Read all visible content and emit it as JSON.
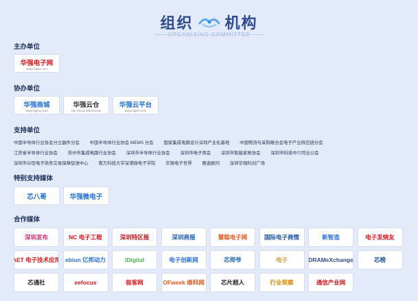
{
  "header": {
    "title_left": "组织",
    "title_right": "机构",
    "subtitle": "ORGANIZING COMMITTEE"
  },
  "sections": {
    "host": "主办单位",
    "co_host": "协办单位",
    "support": "支持单位",
    "special_media": "特别支持媒体",
    "media": "合作媒体"
  },
  "host_logos": [
    {
      "main": "华强电子网",
      "sub": "www.hqew.com",
      "color": "#d6161c"
    }
  ],
  "co_host_logos": [
    {
      "main": "华强商城",
      "sub": "www.hqbuy.com",
      "color": "#1f6fd6"
    },
    {
      "main": "华强云仓",
      "sub": "HQ Cloud Warehouse",
      "color": "#333333"
    },
    {
      "main": "华强云平台",
      "sub": "www.hqpm.com",
      "color": "#1f6fd6"
    }
  ],
  "support_rows": [
    [
      "中国半导体行业协会分立器件分会",
      "中国半导体行业协会 MEMS 分会",
      "国家集成电路设计深圳产业化基地",
      "中国物流与采购联合会电子产业供应链分会"
    ],
    [
      "江苏省半导体行业协会",
      "苏州市集成电路行业协会",
      "深圳市半导体行业协会",
      "深圳市电子商会",
      "深圳市智能家居协会",
      "深圳市科技中介同业公会"
    ],
    [
      "深圳市众恒电子商务交易保障促进中心",
      "南方科技大学深港微电子学院",
      "华强电子世界",
      "赛迪顾问",
      "深圳华强科创广场"
    ]
  ],
  "special_media_logos": [
    {
      "main": "芯八哥",
      "color": "#1f6fd6"
    },
    {
      "main": "华强微电子",
      "color": "#1f6fd6"
    }
  ],
  "media_logos": [
    {
      "main": "深圳发布",
      "color": "#d62b6d"
    },
    {
      "main": "NC 电子工程",
      "color": "#d6161c"
    },
    {
      "main": "深圳特区报",
      "color": "#c0181f"
    },
    {
      "main": "深圳商报",
      "color": "#1a5fb4"
    },
    {
      "main": "慧聪电子网",
      "color": "#e4571d"
    },
    {
      "main": "国际电子商情",
      "color": "#1a4fa0"
    },
    {
      "main": "新智造",
      "color": "#2a6fdb"
    },
    {
      "main": "电子发烧友",
      "color": "#d6161c"
    },
    {
      "main": "AET 电子技术应用",
      "color": "#d6161c"
    },
    {
      "main": "ebiun 亿邦动力",
      "color": "#2a6fdb"
    },
    {
      "main": "iDigital",
      "color": "#4caf50"
    },
    {
      "main": "电子创新网",
      "color": "#2a6fdb"
    },
    {
      "main": "芯师爷",
      "color": "#1a5fb4"
    },
    {
      "main": "电子",
      "color": "#c8a040"
    },
    {
      "main": "DRAMeXchange",
      "color": "#2f4d8c"
    },
    {
      "main": "芯榜",
      "color": "#1a4fa0"
    },
    {
      "main": "芯通社",
      "color": "#222222"
    },
    {
      "main": "eefocus",
      "color": "#d6161c"
    },
    {
      "main": "极客网",
      "color": "#d6161c"
    },
    {
      "main": "OFweek 维科网",
      "color": "#e4571d"
    },
    {
      "main": "芯片超人",
      "color": "#222222"
    },
    {
      "main": "行业观察",
      "color": "#e08a00"
    },
    {
      "main": "通信产业网",
      "color": "#d6161c"
    }
  ]
}
